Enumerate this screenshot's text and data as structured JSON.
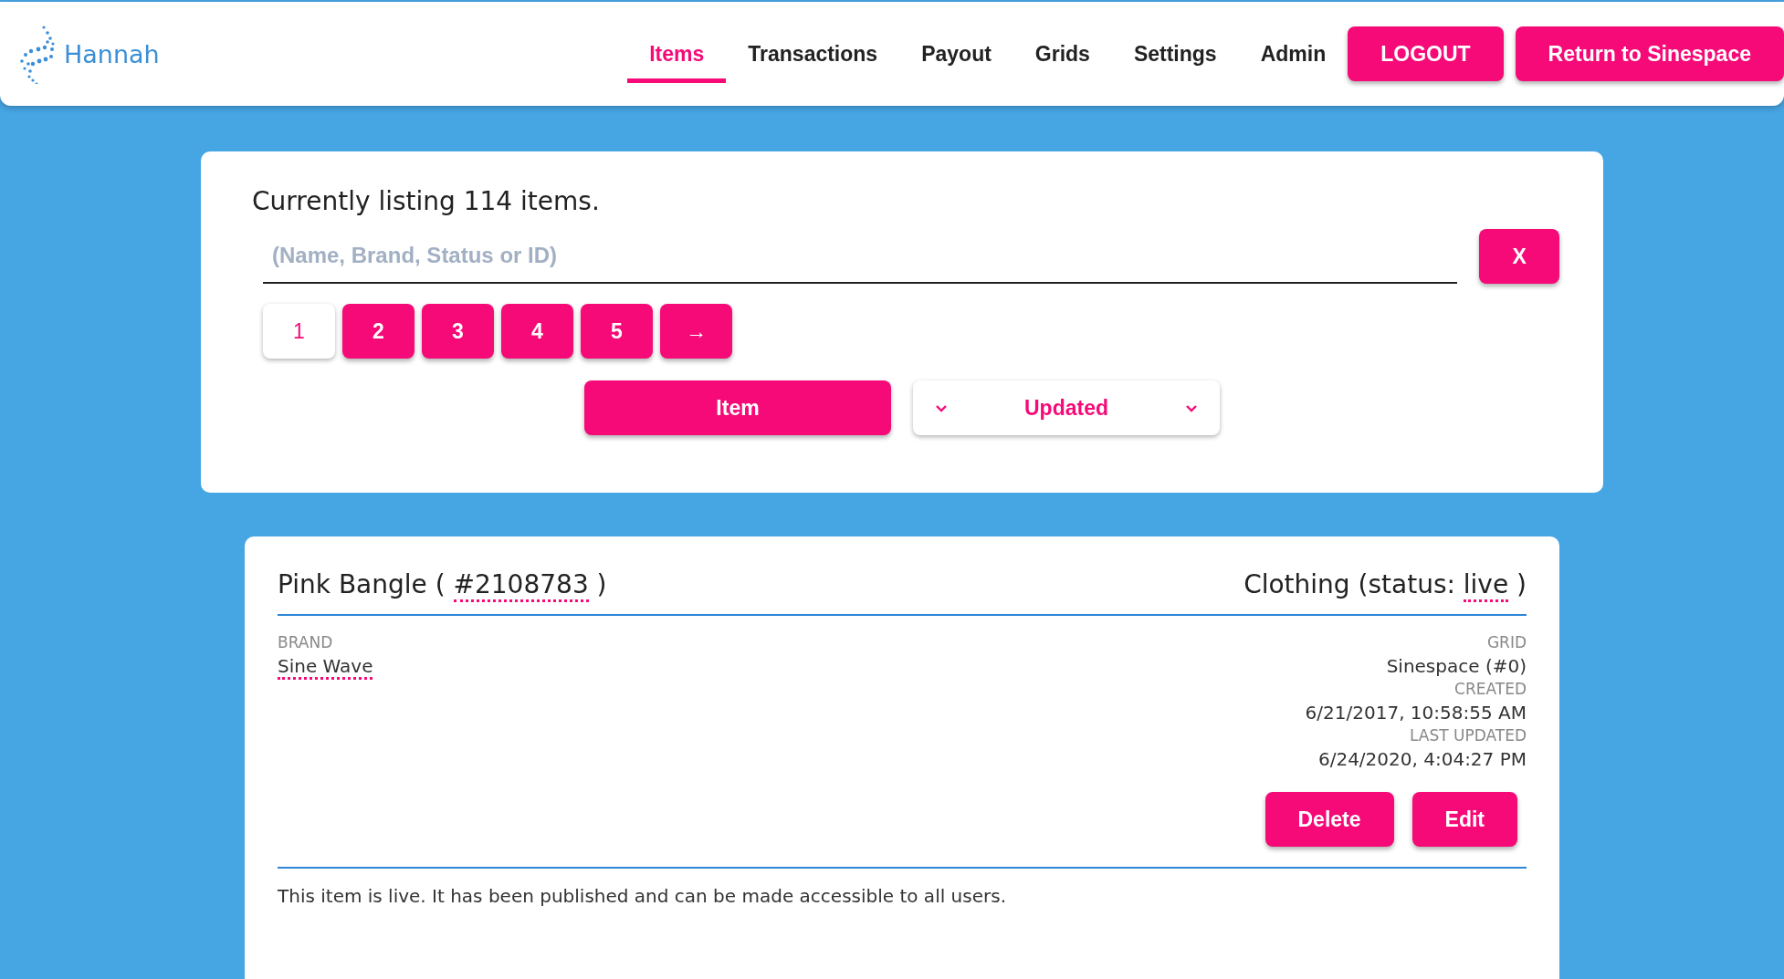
{
  "logo": {
    "text": "Hannah"
  },
  "nav": [
    {
      "label": "Items",
      "selected": true
    },
    {
      "label": "Transactions",
      "selected": false
    },
    {
      "label": "Payout",
      "selected": false
    },
    {
      "label": "Grids",
      "selected": false
    },
    {
      "label": "Settings",
      "selected": false
    },
    {
      "label": "Admin",
      "selected": false
    }
  ],
  "header_buttons": [
    "LOGOUT",
    "Return to Sinespace"
  ],
  "listing": {
    "summary": "Currently listing 114 items.",
    "search": {
      "placeholder": "(Name, Brand, Status or ID)"
    },
    "clear_button": "X",
    "pages": [
      {
        "label": "1",
        "selected": true
      },
      {
        "label": "2",
        "selected": false
      },
      {
        "label": "3",
        "selected": false
      },
      {
        "label": "4",
        "selected": false
      },
      {
        "label": "5",
        "selected": false
      },
      {
        "label": "→",
        "selected": false
      }
    ],
    "sort_field": "Item",
    "sort_order": "Updated"
  },
  "item": {
    "title_start": "Pink Bangle (",
    "id": "#2108783",
    "title_end": ")",
    "category_start": "Clothing (status:",
    "status": "live",
    "category_end": ")",
    "brand_label": "BRAND",
    "brand": "Sine Wave",
    "details": [
      {
        "label": "GRID",
        "value": "Sinespace (#0)"
      },
      {
        "label": "CREATED",
        "value": "6/21/2017, 10:58:55 AM"
      },
      {
        "label": "LAST UPDATED",
        "value": "6/24/2020, 4:04:27 PM"
      }
    ],
    "actions": [
      "Delete",
      "Edit"
    ],
    "note": "This item is live. It has been published and can be made accessible to all users."
  }
}
